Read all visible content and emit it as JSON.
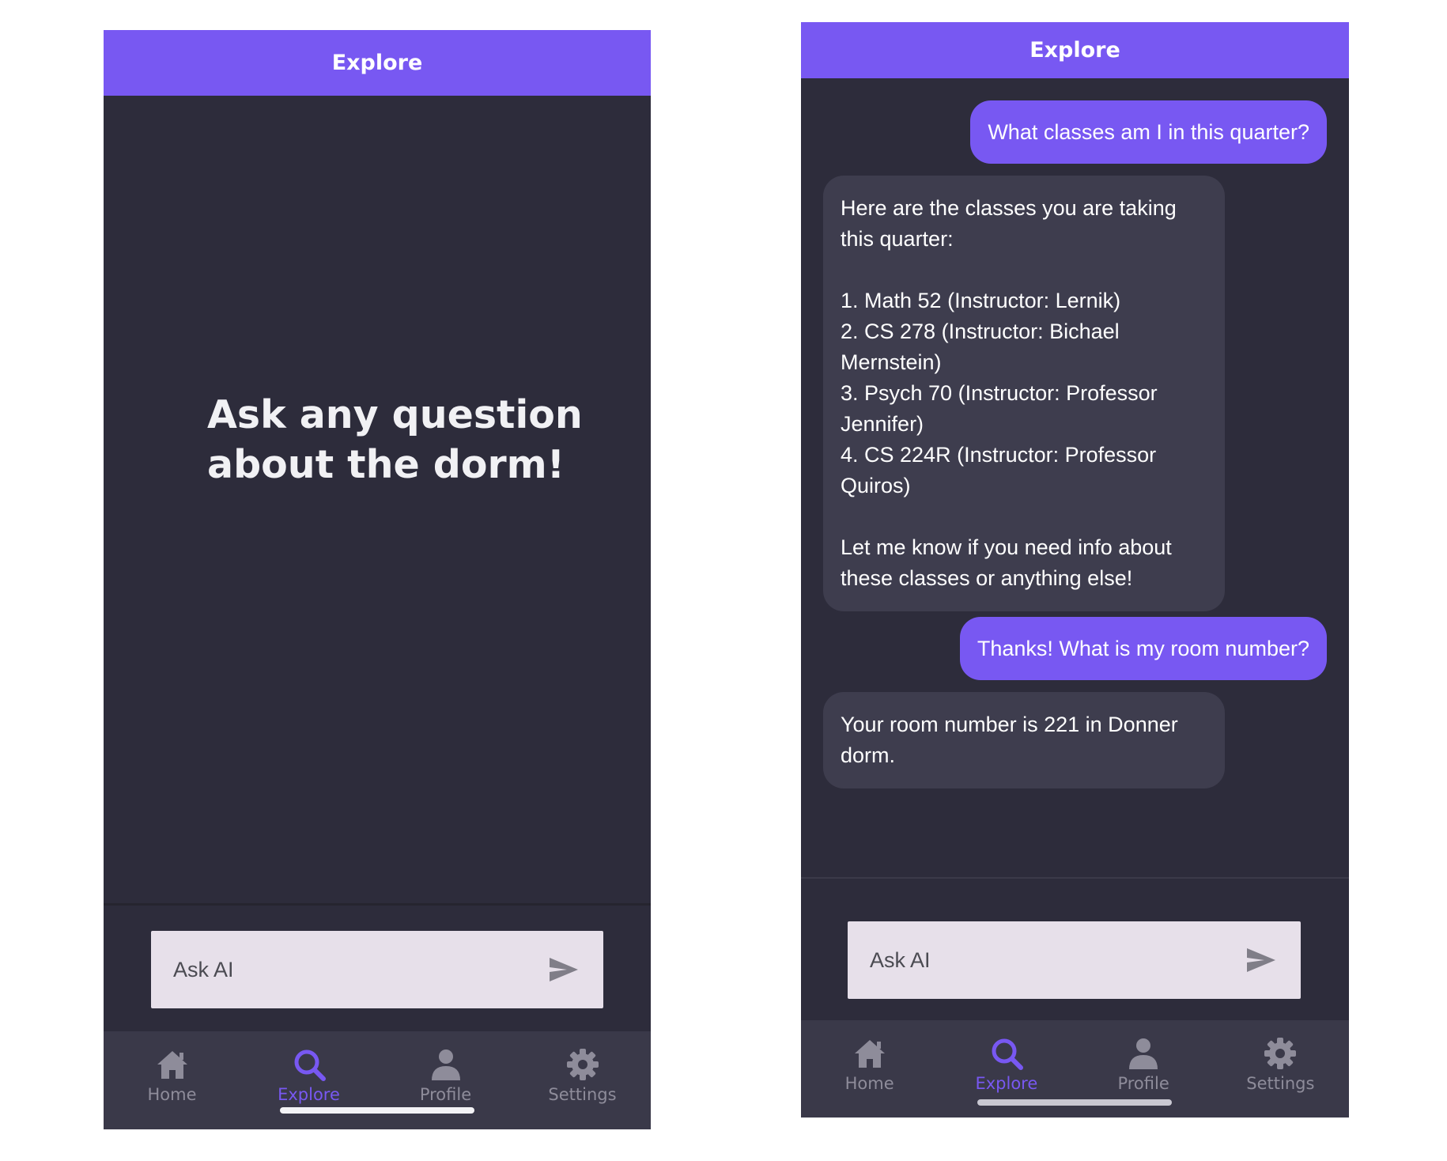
{
  "left": {
    "header_title": "Explore",
    "hero_text": "Ask any question about the dorm!",
    "input_placeholder": "Ask AI",
    "tabs": [
      {
        "label": "Home",
        "icon": "home-icon"
      },
      {
        "label": "Explore",
        "icon": "search-icon",
        "active": true
      },
      {
        "label": "Profile",
        "icon": "person-icon"
      },
      {
        "label": "Settings",
        "icon": "gear-icon"
      }
    ]
  },
  "right": {
    "header_title": "Explore",
    "messages": [
      {
        "role": "user",
        "text": "What classes am I in this quarter?"
      },
      {
        "role": "assistant",
        "text": "Here are the classes you are taking this quarter:\n\n1. Math 52 (Instructor: Lernik)\n2. CS 278 (Instructor: Bichael Mernstein)\n3. Psych 70 (Instructor: Professor Jennifer)\n4. CS 224R (Instructor: Professor Quiros)\n\nLet me know if you need info about these classes or anything else!"
      },
      {
        "role": "user",
        "text": "Thanks! What is my room number?"
      },
      {
        "role": "assistant",
        "text": "Your room number is 221 in Donner dorm."
      }
    ],
    "input_placeholder": "Ask AI",
    "tabs": [
      {
        "label": "Home",
        "icon": "home-icon"
      },
      {
        "label": "Explore",
        "icon": "search-icon",
        "active": true
      },
      {
        "label": "Profile",
        "icon": "person-icon"
      },
      {
        "label": "Settings",
        "icon": "gear-icon"
      }
    ]
  },
  "colors": {
    "accent": "#7858f2",
    "background": "#2d2c3b",
    "assistant_bubble": "#3e3d4e",
    "tabbar": "#3a3949",
    "input": "#e7e0ea"
  }
}
